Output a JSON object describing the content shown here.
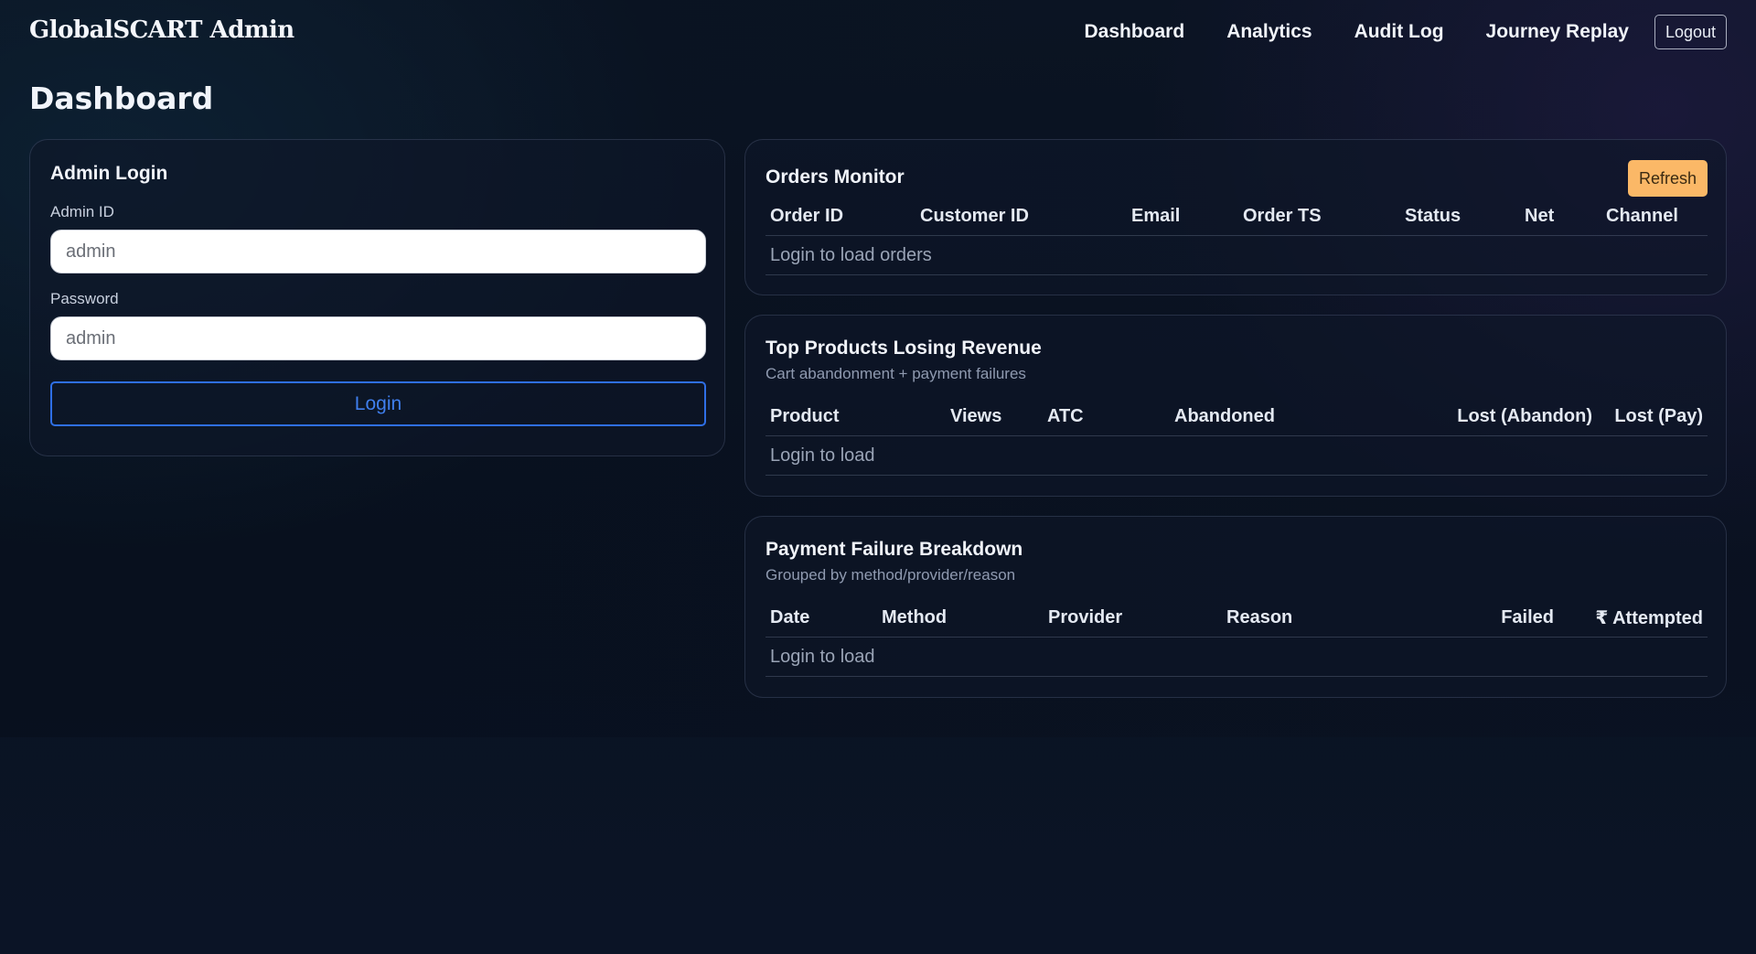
{
  "app": {
    "title": "GlobalSCART Admin"
  },
  "nav": {
    "links": [
      "Dashboard",
      "Analytics",
      "Audit Log",
      "Journey Replay"
    ],
    "logout_label": "Logout"
  },
  "page": {
    "title": "Dashboard"
  },
  "login": {
    "title": "Admin Login",
    "admin_id_label": "Admin ID",
    "admin_id_placeholder": "admin",
    "password_label": "Password",
    "password_placeholder": "admin",
    "button_label": "Login"
  },
  "orders": {
    "title": "Orders Monitor",
    "refresh_label": "Refresh",
    "columns": [
      "Order ID",
      "Customer ID",
      "Email",
      "Order TS",
      "Status",
      "Net",
      "Channel"
    ],
    "empty_text": "Login to load orders"
  },
  "top_products": {
    "title": "Top Products Losing Revenue",
    "subtitle": "Cart abandonment + payment failures",
    "columns": [
      "Product",
      "Views",
      "ATC",
      "Abandoned",
      "Lost (Abandon)",
      "Lost (Pay)"
    ],
    "empty_text": "Login to load"
  },
  "payment_failures": {
    "title": "Payment Failure Breakdown",
    "subtitle": "Grouped by method/provider/reason",
    "columns": [
      "Date",
      "Method",
      "Provider",
      "Reason",
      "Failed",
      "₹ Attempted"
    ],
    "empty_text": "Login to load"
  },
  "colors": {
    "accent_blue": "#2f6fe6",
    "refresh_orange": "#fbb867",
    "background": "#0b1426"
  }
}
